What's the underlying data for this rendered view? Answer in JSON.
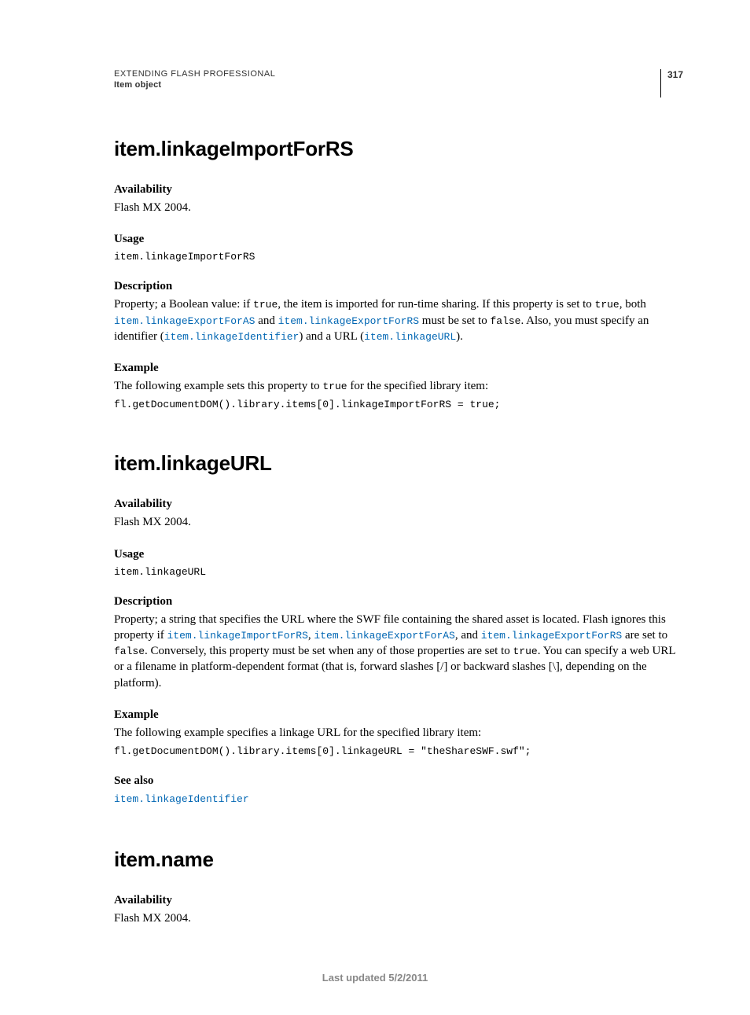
{
  "header": {
    "running_title": "EXTENDING FLASH PROFESSIONAL",
    "section_label": "Item object",
    "page_number": "317"
  },
  "sections": [
    {
      "title": "item.linkageImportForRS",
      "availability_label": "Availability",
      "availability_text": "Flash MX 2004.",
      "usage_label": "Usage",
      "usage_code": "item.linkageImportForRS",
      "description_label": "Description",
      "desc_pre": "Property; a Boolean value: if ",
      "desc_code1": "true",
      "desc_mid1": ", the item is imported for run-time sharing. If this property is set to ",
      "desc_code2": "true",
      "desc_mid2": ", both ",
      "desc_link1": "item.linkageExportForAS",
      "desc_mid3": " and ",
      "desc_link2": "item.linkageExportForRS",
      "desc_mid4": " must be set to ",
      "desc_code3": "false",
      "desc_mid5": ". Also, you must specify an identifier (",
      "desc_link3": "item.linkageIdentifier",
      "desc_mid6": ") and a URL (",
      "desc_link4": "item.linkageURL",
      "desc_mid7": ").",
      "example_label": "Example",
      "example_intro_pre": "The following example sets this property to ",
      "example_intro_code": "true",
      "example_intro_post": " for the specified library item:",
      "example_code": "fl.getDocumentDOM().library.items[0].linkageImportForRS = true;"
    },
    {
      "title": "item.linkageURL",
      "availability_label": "Availability",
      "availability_text": "Flash MX 2004.",
      "usage_label": "Usage",
      "usage_code": "item.linkageURL",
      "description_label": "Description",
      "desc_pre": "Property; a string that specifies the URL where the SWF file containing the shared asset is located. Flash ignores this property if ",
      "desc_link1": "item.linkageImportForRS",
      "desc_sep1": ", ",
      "desc_link2": "item.linkageExportForAS",
      "desc_sep2": ", and ",
      "desc_link3": "item.linkageExportForRS",
      "desc_mid1": " are set to ",
      "desc_code1": "false",
      "desc_mid2": ". Conversely, this property must be set when any of those properties are set to ",
      "desc_code2": "true",
      "desc_mid3": ". You can specify a web URL or a filename in platform-dependent format (that is, forward slashes [/] or backward slashes [\\], depending on the platform).",
      "example_label": "Example",
      "example_intro": "The following example specifies a linkage URL for the specified library item:",
      "example_code": "fl.getDocumentDOM().library.items[0].linkageURL = \"theShareSWF.swf\";",
      "seealso_label": "See also",
      "seealso_link": "item.linkageIdentifier"
    },
    {
      "title": "item.name",
      "availability_label": "Availability",
      "availability_text": "Flash MX 2004."
    }
  ],
  "footer": "Last updated 5/2/2011"
}
